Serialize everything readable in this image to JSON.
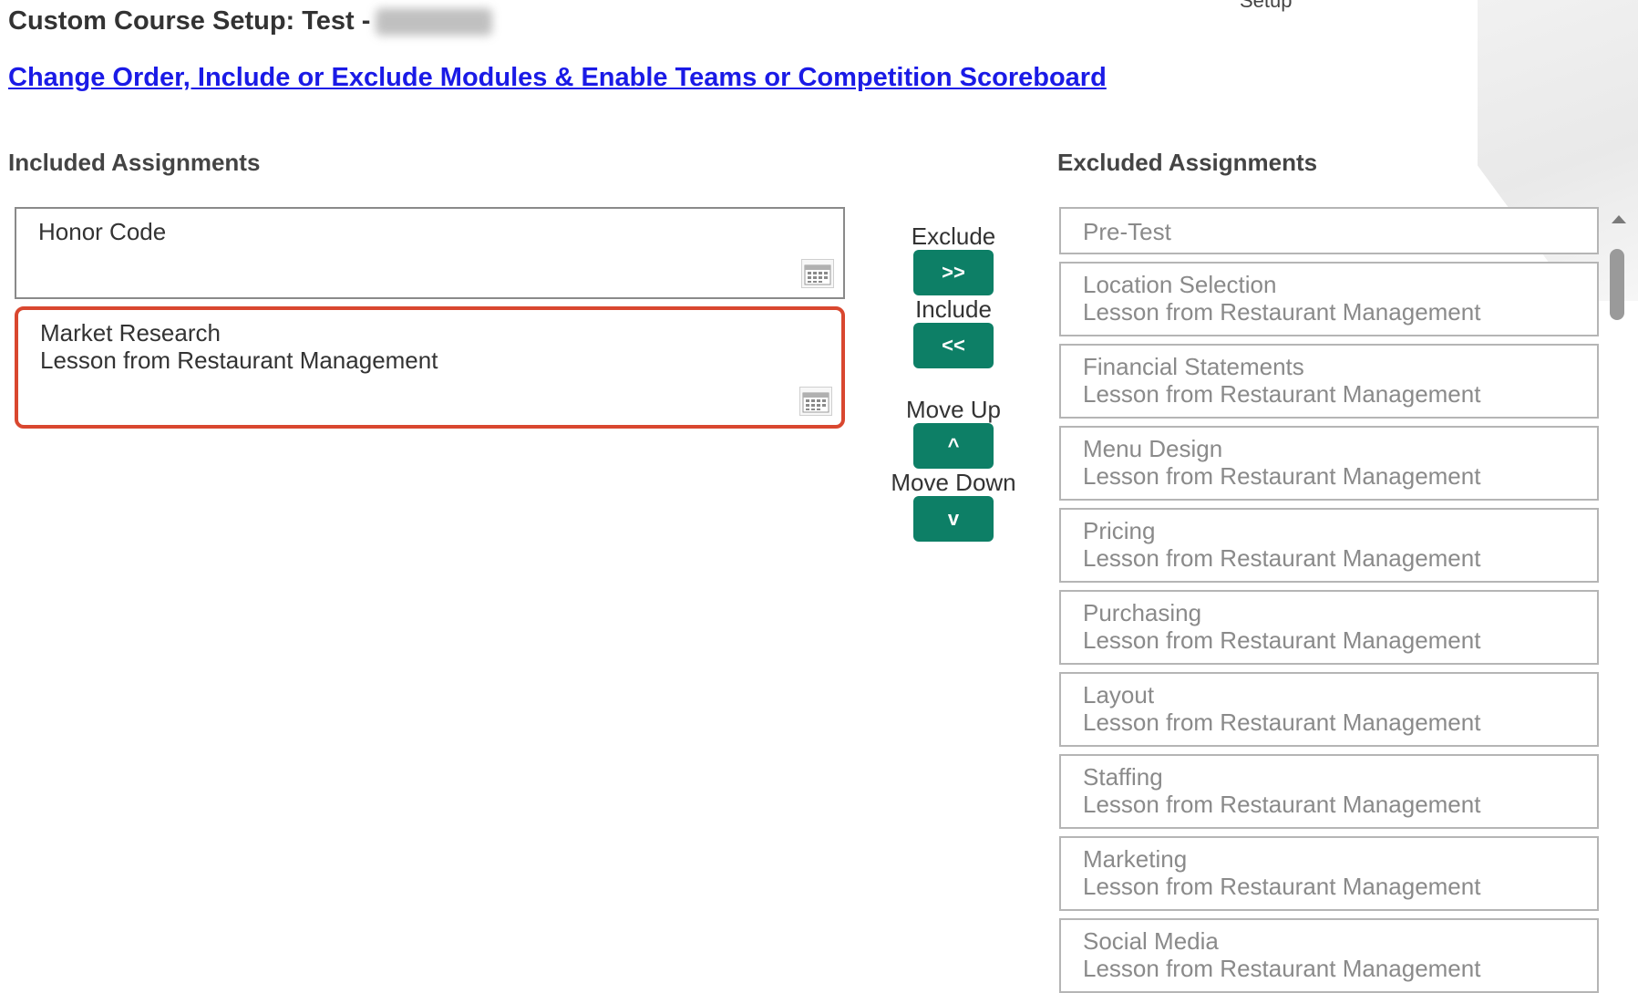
{
  "header": {
    "title": "Custom Course Setup: Test -",
    "setup_fragment": "Setup",
    "nav_link": "Change Order, Include or Exclude Modules & Enable Teams or Competition Scoreboard"
  },
  "included": {
    "heading": "Included Assignments",
    "items": [
      {
        "name": "Honor Code",
        "sub": ""
      },
      {
        "name": "Market Research",
        "sub": "Lesson from Restaurant Management",
        "selected": true
      }
    ]
  },
  "controls": {
    "exclude_label": "Exclude",
    "exclude_button": ">>",
    "include_label": "Include",
    "include_button": "<<",
    "move_up_label": "Move Up",
    "move_up_button": "^",
    "move_down_label": "Move Down",
    "move_down_button": "v"
  },
  "excluded": {
    "heading": "Excluded Assignments",
    "items": [
      {
        "name": "Pre-Test",
        "sub": ""
      },
      {
        "name": "Location Selection",
        "sub": "Lesson from Restaurant Management"
      },
      {
        "name": "Financial Statements",
        "sub": "Lesson from Restaurant Management"
      },
      {
        "name": "Menu Design",
        "sub": "Lesson from Restaurant Management"
      },
      {
        "name": "Pricing",
        "sub": "Lesson from Restaurant Management"
      },
      {
        "name": "Purchasing",
        "sub": "Lesson from Restaurant Management"
      },
      {
        "name": "Layout",
        "sub": "Lesson from Restaurant Management"
      },
      {
        "name": "Staffing",
        "sub": "Lesson from Restaurant Management"
      },
      {
        "name": "Marketing",
        "sub": "Lesson from Restaurant Management"
      },
      {
        "name": "Social Media",
        "sub": "Lesson from Restaurant Management"
      }
    ]
  },
  "colors": {
    "button_green": "#0d7f66",
    "link_blue": "#1a1ae6",
    "selection_red": "#d9472f"
  },
  "icons": [
    "calendar-icon",
    "scroll-up-arrow-icon"
  ]
}
